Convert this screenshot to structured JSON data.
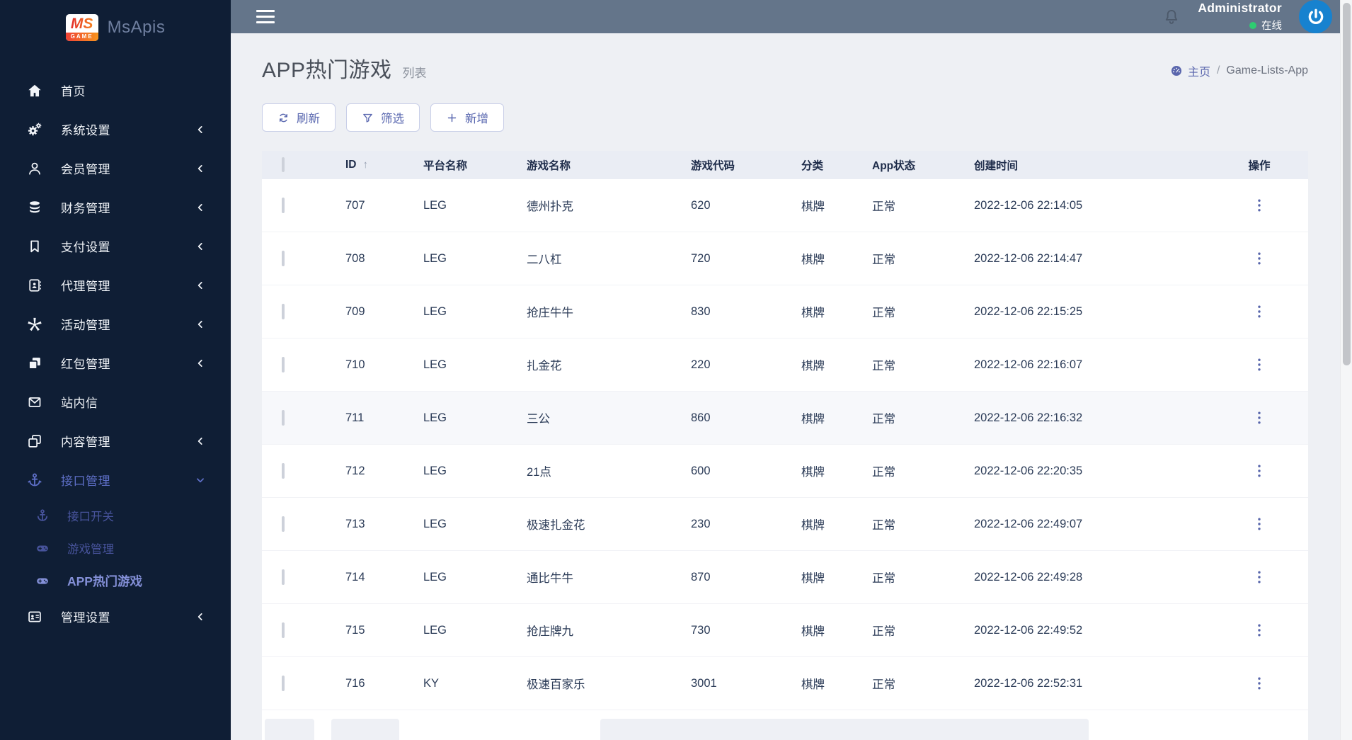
{
  "brand": {
    "logo_primary": "MS",
    "logo_secondary": "GAME",
    "app_name": "MsApis"
  },
  "topbar": {
    "menu_icon": "hamburger-icon",
    "bell_icon": "bell-icon",
    "username": "Administrator",
    "online_status": "在线",
    "avatar_icon": "power-icon"
  },
  "sidebar": {
    "items": [
      {
        "label": "首页",
        "icon": "home-icon"
      },
      {
        "label": "系统设置",
        "icon": "gears-icon",
        "chevron": "left"
      },
      {
        "label": "会员管理",
        "icon": "user-icon",
        "chevron": "left"
      },
      {
        "label": "财务管理",
        "icon": "database-icon",
        "chevron": "left"
      },
      {
        "label": "支付设置",
        "icon": "bookmark-icon",
        "chevron": "left"
      },
      {
        "label": "代理管理",
        "icon": "address-book-icon",
        "chevron": "left"
      },
      {
        "label": "活动管理",
        "icon": "burst-icon",
        "chevron": "left"
      },
      {
        "label": "红包管理",
        "icon": "cubes-icon",
        "chevron": "left"
      },
      {
        "label": "站内信",
        "icon": "envelope-icon"
      },
      {
        "label": "内容管理",
        "icon": "copy-icon",
        "chevron": "left"
      },
      {
        "label": "接口管理",
        "icon": "anchor-icon",
        "chevron": "down",
        "expanded": true,
        "children": [
          {
            "label": "接口开关",
            "icon": "anchor-icon",
            "active": false
          },
          {
            "label": "游戏管理",
            "icon": "gamepad-icon",
            "active": false
          },
          {
            "label": "APP热门游戏",
            "icon": "gamepad-icon",
            "active": true
          }
        ]
      },
      {
        "label": "管理设置",
        "icon": "id-card-icon",
        "chevron": "left"
      }
    ]
  },
  "page": {
    "title": "APP热门游戏",
    "subtitle": "列表",
    "breadcrumb": {
      "home_icon": "dashboard-icon",
      "home": "主页",
      "separator": "/",
      "current": "Game-Lists-App"
    }
  },
  "toolbar": {
    "refresh_label": "刷新",
    "filter_label": "筛选",
    "add_label": "新增",
    "refresh_icon": "refresh-icon",
    "filter_icon": "funnel-icon",
    "add_icon": "plus-icon"
  },
  "table": {
    "columns": {
      "id": "ID",
      "sort_arrow": "↑",
      "platform": "平台名称",
      "game_name": "游戏名称",
      "game_code": "游戏代码",
      "category": "分类",
      "app_status": "App状态",
      "created_at": "创建时间",
      "actions": "操作"
    },
    "rows": [
      {
        "id": "707",
        "platform": "LEG",
        "name": "德州扑克",
        "code": "620",
        "category": "棋牌",
        "status": "正常",
        "created": "2022-12-06 22:14:05"
      },
      {
        "id": "708",
        "platform": "LEG",
        "name": "二八杠",
        "code": "720",
        "category": "棋牌",
        "status": "正常",
        "created": "2022-12-06 22:14:47"
      },
      {
        "id": "709",
        "platform": "LEG",
        "name": "抢庄牛牛",
        "code": "830",
        "category": "棋牌",
        "status": "正常",
        "created": "2022-12-06 22:15:25"
      },
      {
        "id": "710",
        "platform": "LEG",
        "name": "扎金花",
        "code": "220",
        "category": "棋牌",
        "status": "正常",
        "created": "2022-12-06 22:16:07"
      },
      {
        "id": "711",
        "platform": "LEG",
        "name": "三公",
        "code": "860",
        "category": "棋牌",
        "status": "正常",
        "created": "2022-12-06 22:16:32",
        "highlighted": true
      },
      {
        "id": "712",
        "platform": "LEG",
        "name": "21点",
        "code": "600",
        "category": "棋牌",
        "status": "正常",
        "created": "2022-12-06 22:20:35"
      },
      {
        "id": "713",
        "platform": "LEG",
        "name": "极速扎金花",
        "code": "230",
        "category": "棋牌",
        "status": "正常",
        "created": "2022-12-06 22:49:07"
      },
      {
        "id": "714",
        "platform": "LEG",
        "name": "通比牛牛",
        "code": "870",
        "category": "棋牌",
        "status": "正常",
        "created": "2022-12-06 22:49:28"
      },
      {
        "id": "715",
        "platform": "LEG",
        "name": "抢庄牌九",
        "code": "730",
        "category": "棋牌",
        "status": "正常",
        "created": "2022-12-06 22:49:52"
      },
      {
        "id": "716",
        "platform": "KY",
        "name": "极速百家乐",
        "code": "3001",
        "category": "棋牌",
        "status": "正常",
        "created": "2022-12-06 22:52:31"
      }
    ]
  },
  "colors": {
    "sidebar_bg": "#0f1e35",
    "topbar_bg": "#64758a",
    "accent_indigo": "#5a68b0",
    "active_menu": "#5e6fc7",
    "submenu_active": "#8490d8",
    "status_green": "#2ecc71",
    "avatar_blue": "#1782cf",
    "content_bg": "#eef0f4",
    "table_header_bg": "#eaedf4",
    "logo_gradient_start": "#e22b2b",
    "logo_gradient_end": "#f58220"
  }
}
